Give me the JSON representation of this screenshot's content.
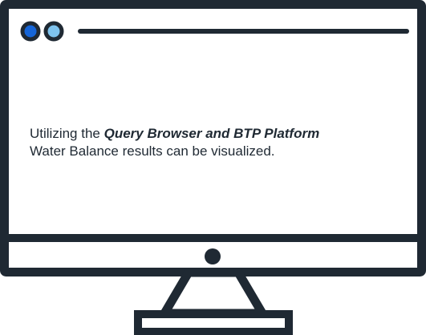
{
  "caption": {
    "lead": "Utilizing the ",
    "emphasis": "Query Browser and BTP Platform",
    "rest": "Water Balance results can be visualized."
  },
  "colors": {
    "outline": "#1f2933",
    "dot_primary": "#1565d8",
    "dot_secondary": "#7ec3ee",
    "background": "#ffffff"
  },
  "icons": {
    "window_dots": "window-control-dots",
    "power_button": "power-button-icon"
  }
}
